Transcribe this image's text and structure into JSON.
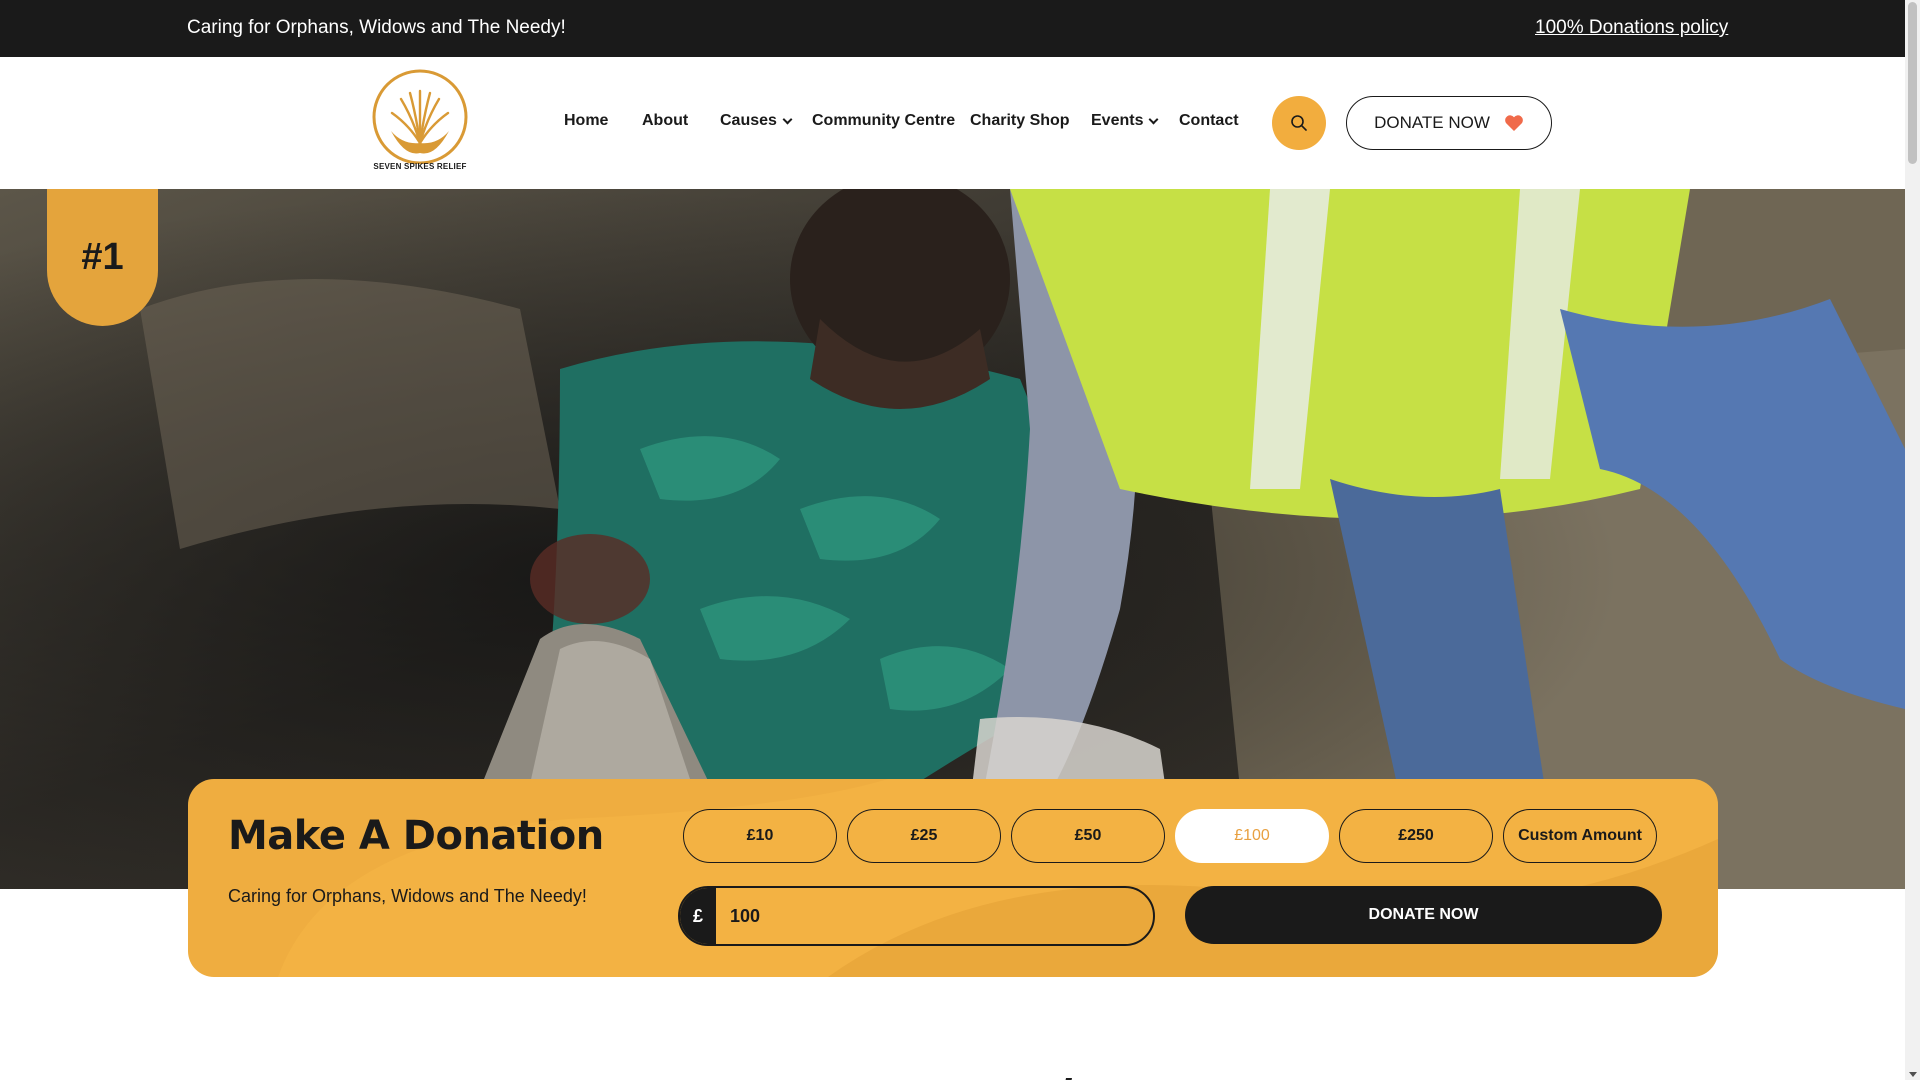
{
  "topbar": {
    "tagline": "Caring for Orphans, Widows and The Needy!",
    "policy_link": "100% Donations policy"
  },
  "header": {
    "logo_text": "SEVEN SPIKES RELIEF",
    "nav": [
      {
        "label": "Home",
        "has_dropdown": false
      },
      {
        "label": "About",
        "has_dropdown": false
      },
      {
        "label": "Causes",
        "has_dropdown": true
      },
      {
        "label": "Community Centre",
        "has_dropdown": false
      },
      {
        "label": "Charity Shop",
        "has_dropdown": false
      },
      {
        "label": "Events",
        "has_dropdown": true
      },
      {
        "label": "Contact",
        "has_dropdown": false
      }
    ],
    "search_icon": "search-icon",
    "donate_label": "DONATE NOW",
    "donate_icon": "heart-icon"
  },
  "hero": {
    "badge": "#1"
  },
  "donation": {
    "title": "Make A Donation",
    "subtitle": "Caring for Orphans, Widows and The Needy!",
    "amounts": [
      "£10",
      "£25",
      "£50",
      "£100",
      "£250",
      "Custom Amount"
    ],
    "selected": "£100",
    "currency": "£",
    "input_value": "100",
    "donate_label": "DONATE NOW"
  },
  "colors": {
    "accent": "#efad40",
    "dark": "#1a1a1a",
    "heart": "#f06a4a"
  }
}
